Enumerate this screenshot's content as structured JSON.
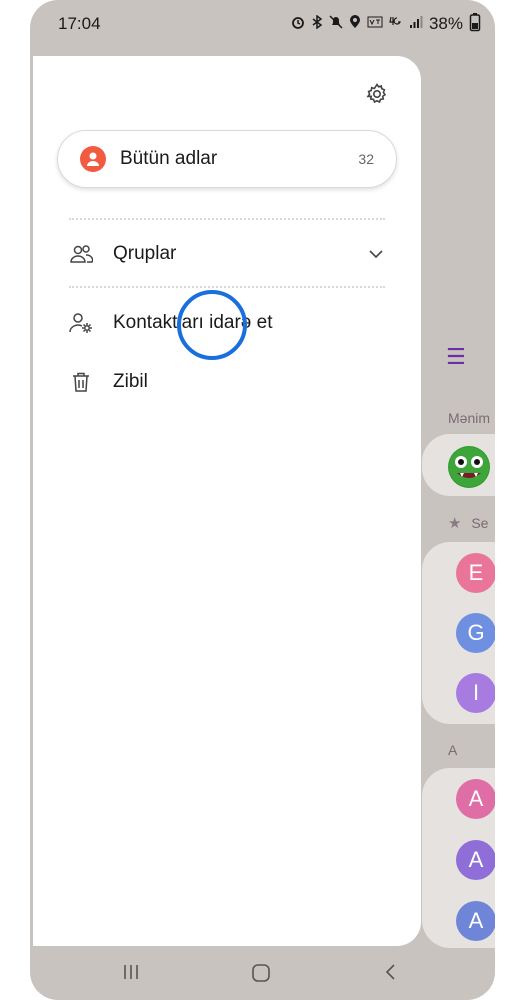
{
  "status_bar": {
    "time": "17:04",
    "icons": [
      "alarm-icon",
      "bluetooth-icon",
      "mute-icon",
      "location-icon",
      "volte-icon",
      "4g-icon",
      "signal-icon"
    ],
    "battery": "38%"
  },
  "drawer": {
    "all_names": {
      "label": "Bütün adlar",
      "count": "32"
    },
    "groups_label": "Qruplar",
    "manage_contacts_label": "Kontaktları idarə et",
    "trash_label": "Zibil"
  },
  "background_list": {
    "section_me": "Mənim",
    "section_favorites": "Se",
    "section_a": "A",
    "favorites": [
      {
        "letter": "E",
        "color": "#e9759a"
      },
      {
        "letter": "G",
        "color": "#6f8fe0"
      },
      {
        "letter": "I",
        "color": "#a77be0"
      }
    ],
    "a_contacts": [
      {
        "letter": "A",
        "color": "#e06ea6"
      },
      {
        "letter": "A",
        "color": "#8f6ed8"
      },
      {
        "letter": "A",
        "color": "#6f86d8"
      }
    ]
  },
  "colors": {
    "accent": "#1a6fde",
    "avatar_orange": "#f15b40"
  }
}
